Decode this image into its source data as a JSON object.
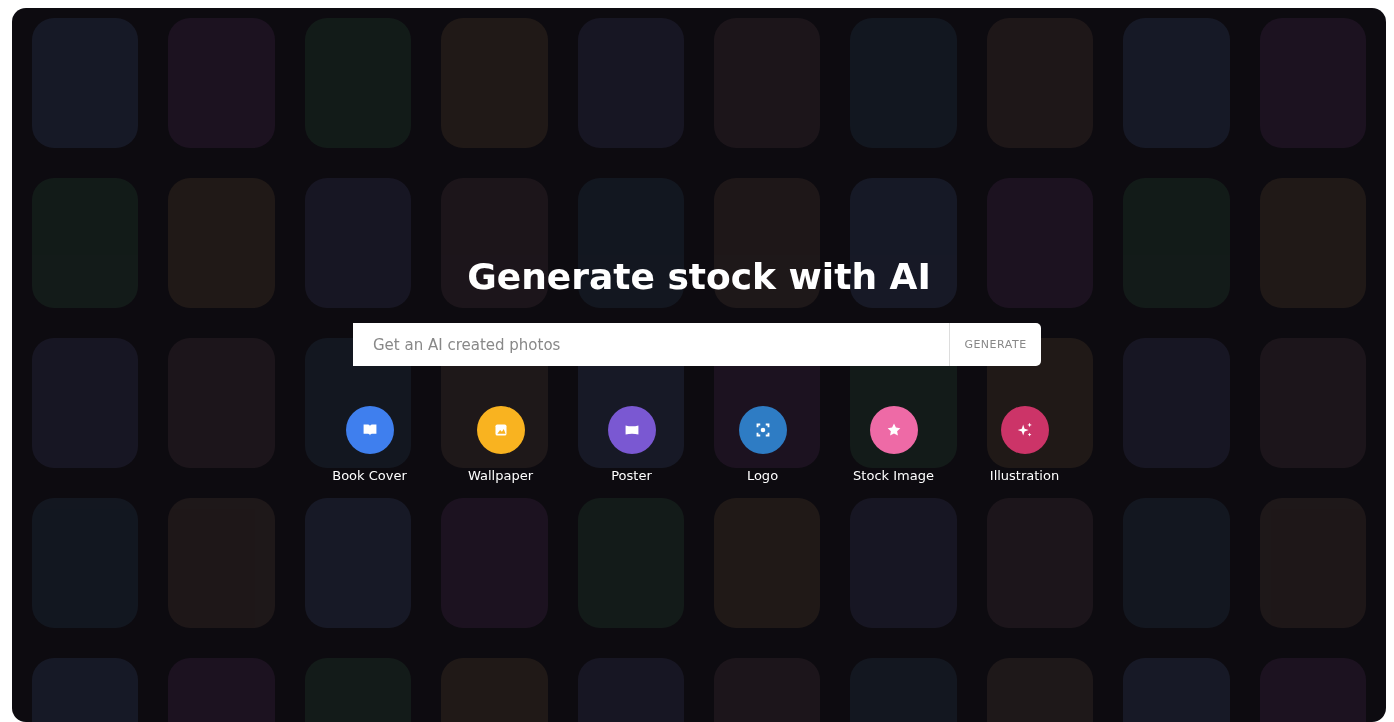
{
  "hero": {
    "title": "Generate stock with AI"
  },
  "search": {
    "placeholder": "Get an AI created photos",
    "button": "GENERATE"
  },
  "categories": [
    {
      "label": "Book Cover",
      "kind": "book",
      "color": "#3f7fee"
    },
    {
      "label": "Wallpaper",
      "kind": "image",
      "color": "#f9b320"
    },
    {
      "label": "Poster",
      "kind": "panel",
      "color": "#7a58d2"
    },
    {
      "label": "Logo",
      "kind": "focus",
      "color": "#2e7cc4"
    },
    {
      "label": "Stock Image",
      "kind": "star",
      "color": "#ee6aa6"
    },
    {
      "label": "Illustration",
      "kind": "sparkle",
      "color": "#cc3468"
    }
  ]
}
